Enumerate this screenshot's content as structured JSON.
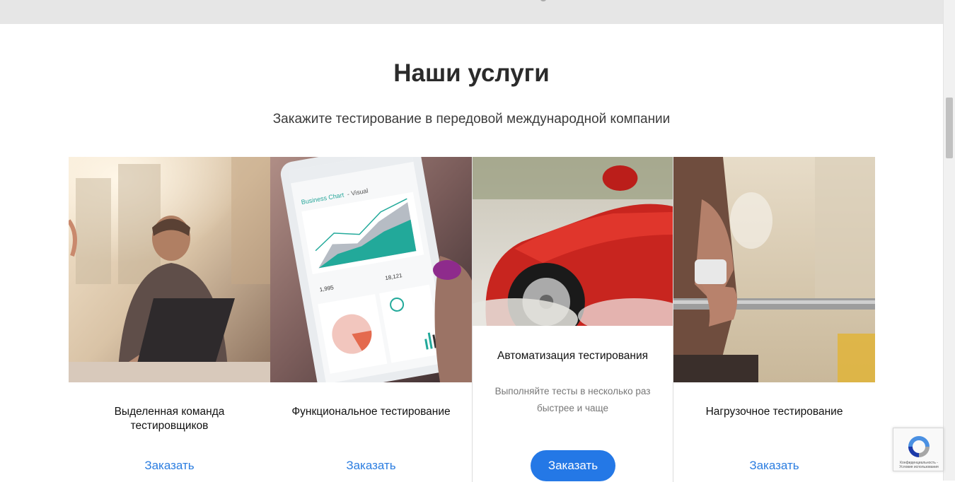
{
  "section": {
    "title": "Наши услуги",
    "subtitle": "Закажите тестирование в передовой международной компании"
  },
  "cards": [
    {
      "title": "Выделенная команда тестировщиков",
      "image": "man-with-laptop-photo",
      "link_label": "Заказать"
    },
    {
      "title": "Функциональное тестирование",
      "image": "tablet-business-chart-photo",
      "link_label": "Заказать"
    },
    {
      "title": "Автоматизация тестирования",
      "description": "Выполняйте тесты в несколько раз быстрее и чаще",
      "image": "red-car-drifting-photo",
      "button_label": "Заказать"
    },
    {
      "title": "Нагрузочное тестирование",
      "image": "weightlifter-barbell-photo",
      "link_label": "Заказать"
    }
  ],
  "tablet_screen": {
    "chart_title": "Business Chart",
    "chart_suffix": "- Visual",
    "stat_1": "1,995",
    "stat_2": "18,121"
  },
  "recaptcha": {
    "icon": "recaptcha-icon",
    "text": "Конфиденциальность - Условия использования"
  },
  "colors": {
    "accent": "#2478e6",
    "link": "#2b7de0",
    "top_band": "#e6e6e6"
  }
}
